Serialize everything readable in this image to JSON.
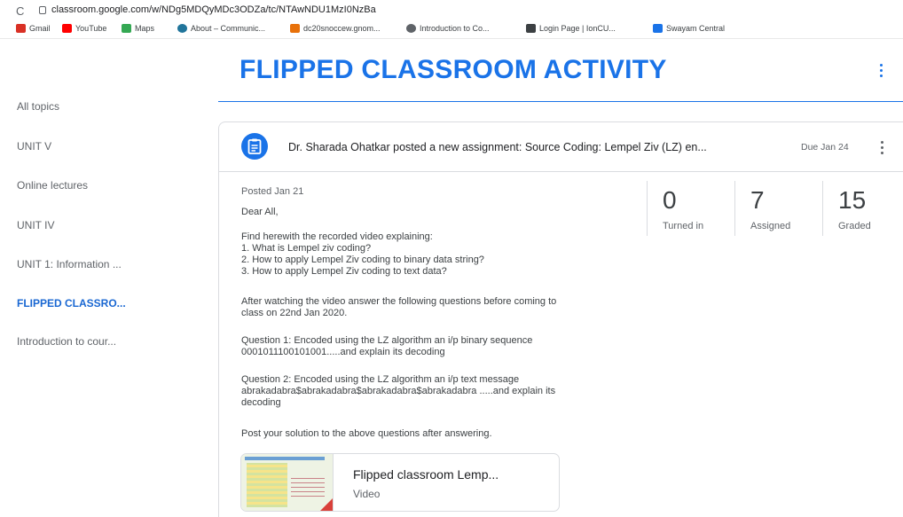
{
  "browser": {
    "url": "classroom.google.com/w/NDg5MDQyMDc3ODZa/tc/NTAwNDU1MzI0NzBa",
    "bookmarks": [
      {
        "label": "Gmail",
        "icon": "gmail-icon",
        "color": "#d93025"
      },
      {
        "label": "YouTube",
        "icon": "youtube-icon",
        "color": "#ff0000"
      },
      {
        "label": "Maps",
        "icon": "maps-icon",
        "color": "#34a853"
      },
      {
        "label": "About – Communic...",
        "icon": "wordpress-icon",
        "color": "#21759b"
      },
      {
        "label": "dc20snoccew.gnom...",
        "icon": "gnomio-icon",
        "color": "#e8710a"
      },
      {
        "label": "Introduction to Co...",
        "icon": "globe-icon",
        "color": "#5f6368"
      },
      {
        "label": "Login Page | IonCU...",
        "icon": "graduation-icon",
        "color": "#3c4043"
      },
      {
        "label": "Swayam Central",
        "icon": "swayam-icon",
        "color": "#1a73e8"
      }
    ]
  },
  "sidebar": {
    "items": [
      {
        "label": "All topics"
      },
      {
        "label": "UNIT V"
      },
      {
        "label": "Online lectures"
      },
      {
        "label": "UNIT IV"
      },
      {
        "label": "UNIT 1: Information ..."
      },
      {
        "label": "FLIPPED CLASSRO..."
      },
      {
        "label": "Introduction to cour..."
      }
    ],
    "active_index": 5
  },
  "topic": {
    "title": "FLIPPED CLASSROOM ACTIVITY"
  },
  "assignment": {
    "header": "Dr. Sharada Ohatkar posted a new assignment: Source Coding: Lempel Ziv (LZ) en...",
    "due": "Due Jan 24",
    "posted": "Posted Jan 21",
    "body": [
      "Dear All,",
      "",
      "Find herewith the recorded video explaining:\n1. What is Lempel ziv coding?\n2. How to apply Lempel Ziv coding to binary data string?\n3. How to apply Lempel Ziv coding to text data?",
      "After watching the video answer the following questions before coming to\nclass on 22nd Jan 2020.",
      "Question 1: Encoded using the LZ algorithm an i/p binary sequence\n0001011100101001.....and explain its decoding",
      "Question 2: Encoded using the LZ algorithm an i/p text message\nabrakadabra$abrakadabra$abrakadabra$abrakadabra .....and explain its\ndecoding",
      "Post your solution to the above questions after answering."
    ],
    "stats": [
      {
        "value": "0",
        "label": "Turned in"
      },
      {
        "value": "7",
        "label": "Assigned"
      },
      {
        "value": "15",
        "label": "Graded"
      }
    ],
    "attachment": {
      "title": "Flipped classroom Lemp...",
      "type": "Video"
    }
  },
  "colors": {
    "accent": "#1a73e8",
    "active_nav": "#1967d2"
  }
}
